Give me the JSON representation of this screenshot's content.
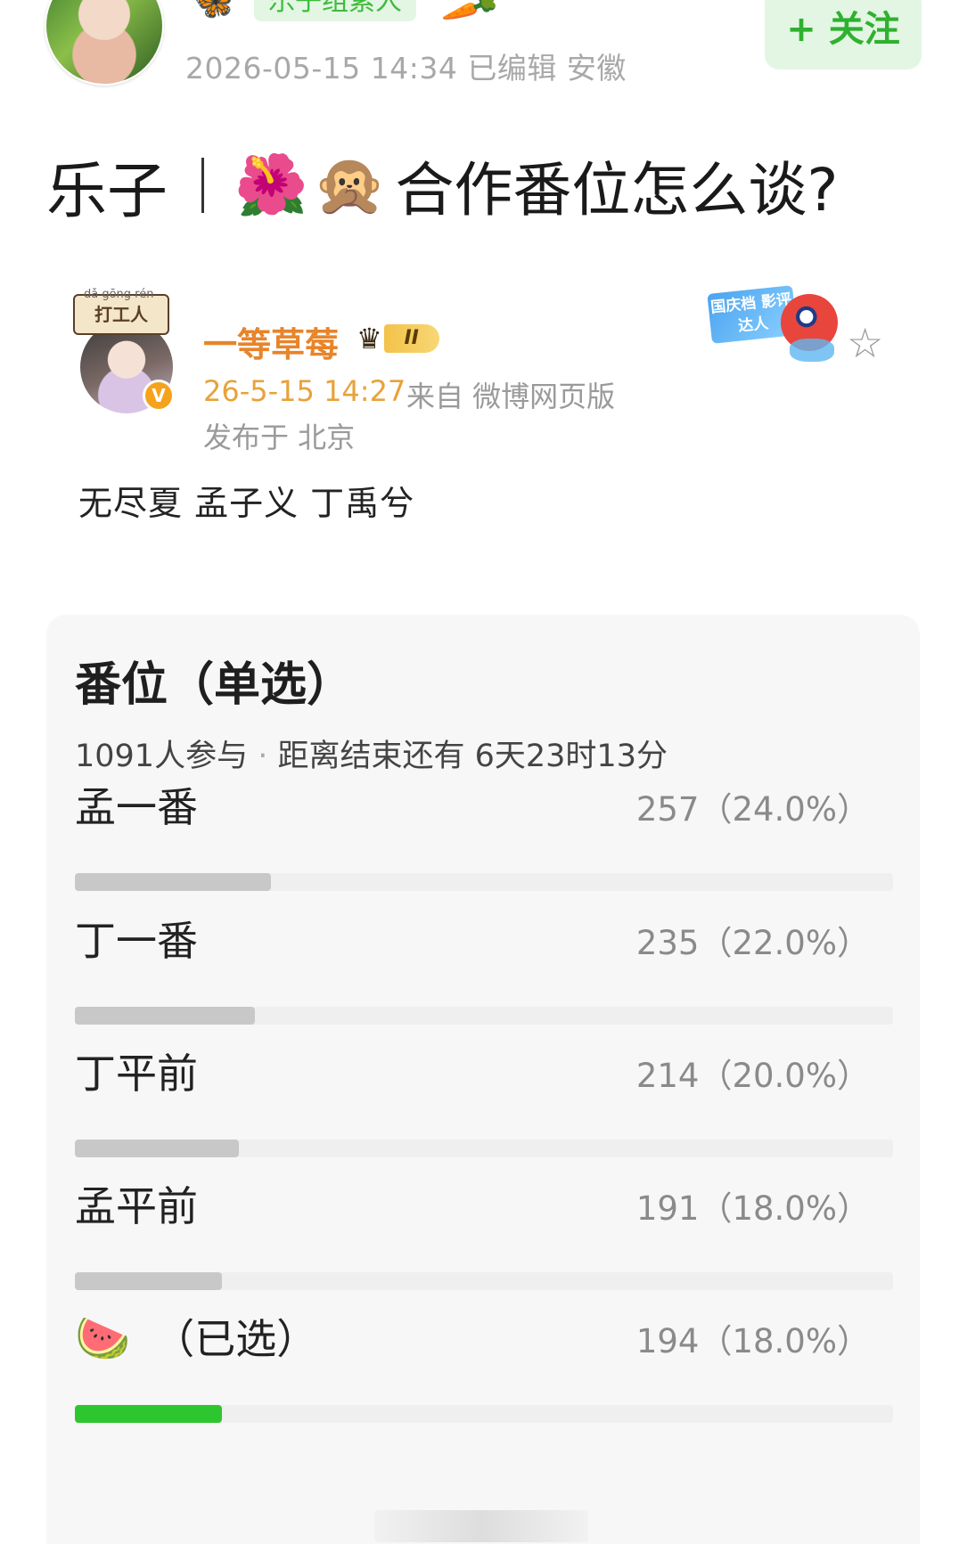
{
  "author": {
    "group_tag": "乐子组素人",
    "meta": "2026-05-15 14:34  已编辑  安徽",
    "follow_label": "+ 关注",
    "avatar_icon": "avatar",
    "decor_icons": [
      "butterfly-icon",
      "carrot-icon"
    ]
  },
  "title": {
    "prefix": "乐子",
    "emoji_1": "🌺",
    "emoji_2": "🙊",
    "text": "合作番位怎么谈?"
  },
  "repost": {
    "badge": "打工人",
    "badge_pinyin": "dǎ gōng rén",
    "username": "一等草莓",
    "level": "II",
    "time": "26-5-15 14:27",
    "source": "来自 微博网页版",
    "location": "发布于 北京",
    "text": "无尽夏 孟子义 丁禹兮",
    "festival_badge": "国庆档 影评达人",
    "verified_mark": "V",
    "colors": {
      "username": "#e8842a",
      "time": "#e8a23a"
    }
  },
  "poll": {
    "title": "番位（单选）",
    "participants": "1091人参与",
    "separator": "·",
    "remaining": "距离结束还有 6天23时13分",
    "options": [
      {
        "label": "孟一番",
        "votes": "257（24.0%）",
        "fraction": 0.24,
        "selected": false
      },
      {
        "label": "丁一番",
        "votes": "235（22.0%）",
        "fraction": 0.22,
        "selected": false
      },
      {
        "label": "丁平前",
        "votes": "214（20.0%）",
        "fraction": 0.2,
        "selected": false
      },
      {
        "label": "孟平前",
        "votes": "191（18.0%）",
        "fraction": 0.18,
        "selected": false
      },
      {
        "label": "（已选）",
        "emoji": "🍉",
        "votes": "194（18.0%）",
        "fraction": 0.18,
        "selected": true
      }
    ],
    "colors": {
      "bar": "#c8c8c8",
      "bar_selected": "#2ec62e",
      "track": "#efefef"
    }
  }
}
